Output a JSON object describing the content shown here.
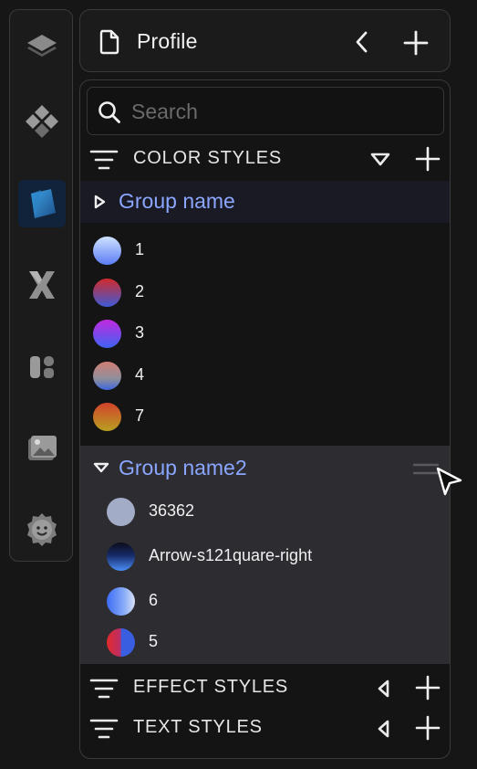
{
  "rail": {
    "items": [
      {
        "name": "layers-icon",
        "active": false
      },
      {
        "name": "components-icon",
        "active": false
      },
      {
        "name": "styles-icon",
        "active": true
      },
      {
        "name": "variables-icon",
        "active": false
      },
      {
        "name": "assets-icon",
        "active": false
      },
      {
        "name": "images-icon",
        "active": false
      },
      {
        "name": "plugins-icon",
        "active": false
      }
    ]
  },
  "header": {
    "title": "Profile",
    "icons": {
      "page": "document-icon",
      "back": "chevron-left-icon",
      "add": "plus-icon"
    }
  },
  "search": {
    "placeholder": "Search",
    "value": ""
  },
  "color_styles": {
    "label": "COLOR STYLES",
    "state": "expanded",
    "groups": [
      {
        "name": "Group name",
        "expanded": false,
        "items": [
          {
            "label": "1"
          },
          {
            "label": "2"
          },
          {
            "label": "3"
          },
          {
            "label": "4"
          },
          {
            "label": "7"
          }
        ]
      },
      {
        "name": "Group name2",
        "expanded": true,
        "items": [
          {
            "label": "36362"
          },
          {
            "label": "Arrow-s121quare-right"
          },
          {
            "label": "6"
          },
          {
            "label": "5"
          }
        ]
      }
    ]
  },
  "effect_styles": {
    "label": "EFFECT STYLES",
    "state": "collapsed"
  },
  "text_styles": {
    "label": "TEXT STYLES",
    "state": "collapsed"
  },
  "colors": {
    "accent": "#8aa6ff",
    "active_rail_bg": "#10233a",
    "expanded_group_bg": "#2c2c31"
  }
}
